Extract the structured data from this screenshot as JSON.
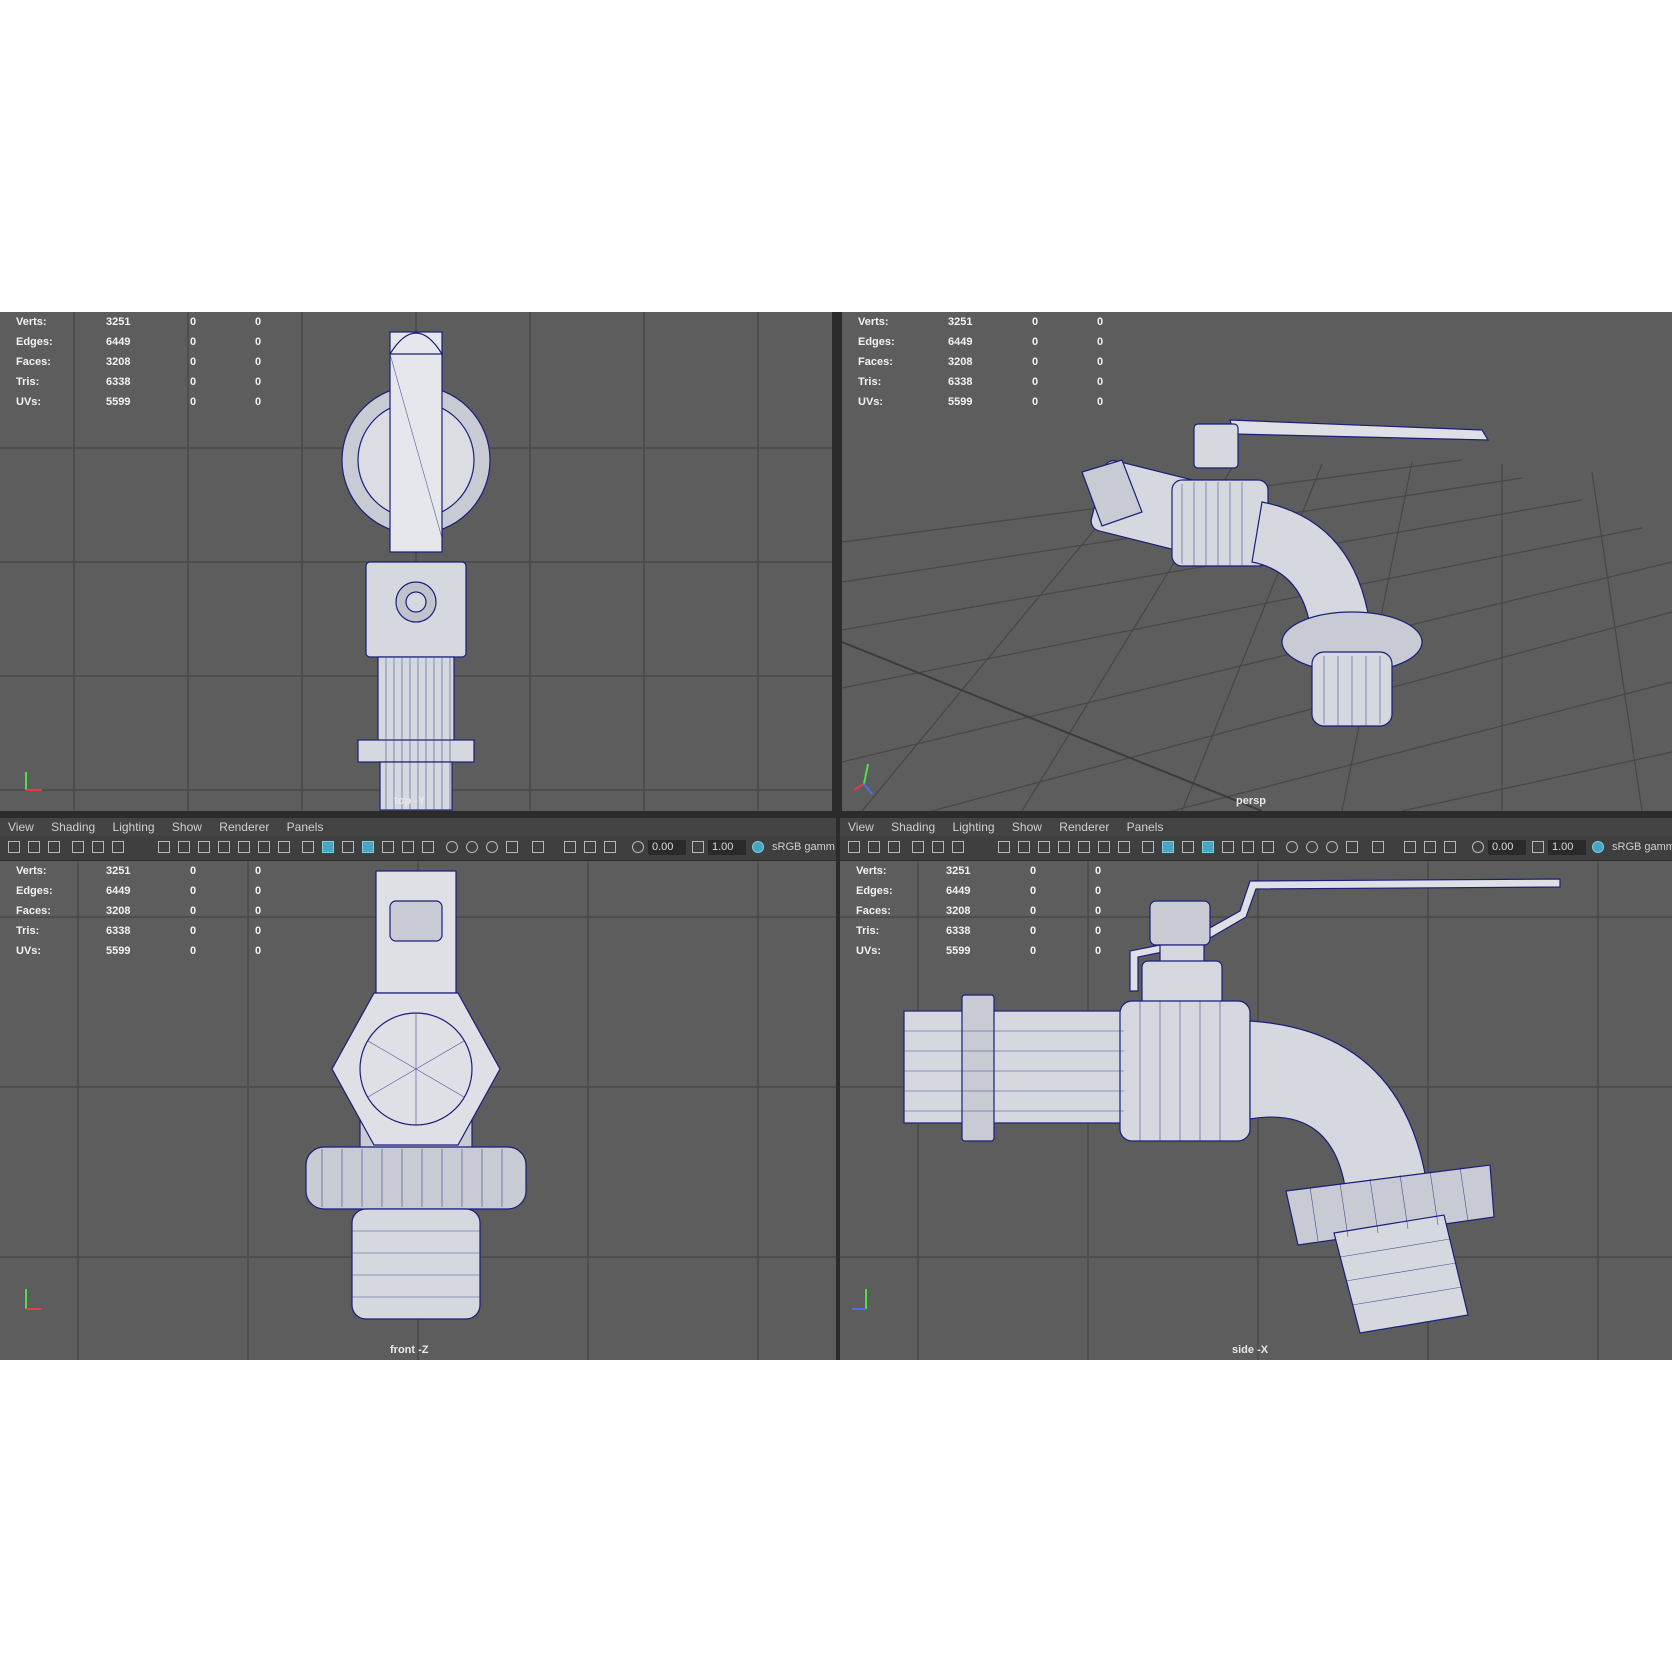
{
  "hud": {
    "rows": [
      {
        "label": "Verts:",
        "value": "3251",
        "a": "0",
        "b": "0"
      },
      {
        "label": "Edges:",
        "value": "6449",
        "a": "0",
        "b": "0"
      },
      {
        "label": "Faces:",
        "value": "3208",
        "a": "0",
        "b": "0"
      },
      {
        "label": "Tris:",
        "value": "6338",
        "a": "0",
        "b": "0"
      },
      {
        "label": "UVs:",
        "value": "5599",
        "a": "0",
        "b": "0"
      }
    ]
  },
  "menu": [
    "View",
    "Shading",
    "Lighting",
    "Show",
    "Renderer",
    "Panels"
  ],
  "toolbar": {
    "value_a": "0.00",
    "value_b": "1.00",
    "color_space": "sRGB gamm"
  },
  "viewports": {
    "top": {
      "label": "top -Y"
    },
    "persp": {
      "label": "persp"
    },
    "front": {
      "label": "front -Z"
    },
    "side": {
      "label": "side -X"
    }
  },
  "colors": {
    "viewport_bg": "#5d5d5d",
    "grid": "#4a4a4a",
    "wire": "#1a1f7a",
    "mesh_fill": "#d6d8e0",
    "active_icon": "#4aa4c0"
  },
  "icons": [
    "camera-icon",
    "grid-icon",
    "wireframe-icon",
    "smooth-shade-icon",
    "light-icon",
    "isolate-icon",
    "exposure-icon",
    "gamma-icon"
  ]
}
